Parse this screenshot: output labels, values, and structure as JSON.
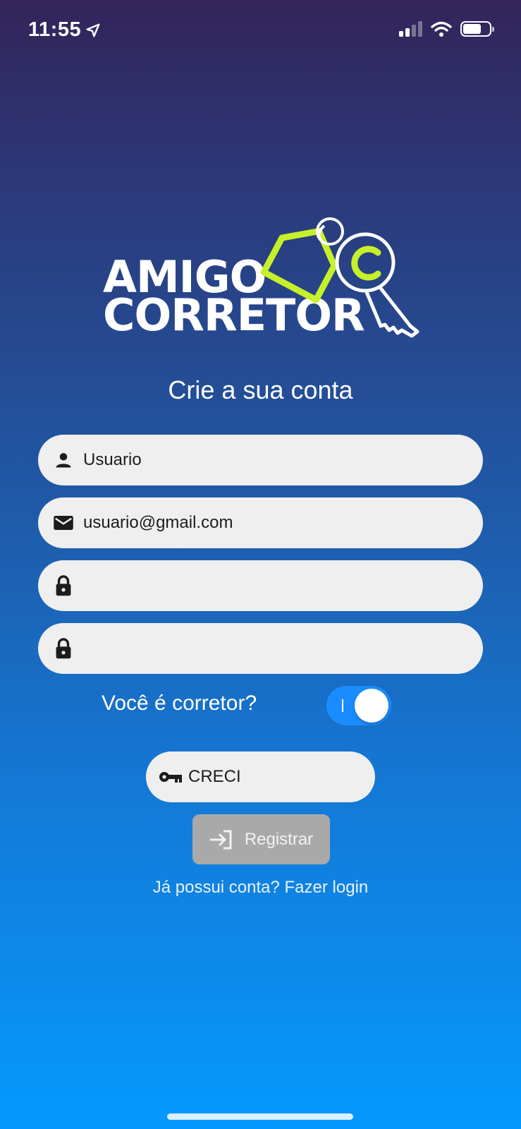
{
  "status_bar": {
    "time": "11:55",
    "icons": [
      "location-arrow-icon",
      "signal-icon",
      "wifi-icon",
      "battery-icon"
    ]
  },
  "logo": {
    "line1": "AMIGO",
    "line2": "CORRETOR",
    "accent": "#c6f028"
  },
  "title": "Crie a sua conta",
  "form": {
    "username": {
      "value": "Usuario",
      "icon": "person-icon"
    },
    "email": {
      "value": "usuario@gmail.com",
      "icon": "mail-icon"
    },
    "password": {
      "value": "",
      "icon": "lock-icon"
    },
    "confirm_password": {
      "value": "",
      "icon": "lock-icon"
    },
    "broker_toggle": {
      "label": "Você é corretor?",
      "on": true
    },
    "creci": {
      "value": "CRECI",
      "icon": "key-icon"
    },
    "register_label": "Registrar",
    "login_link": "Já possui conta? Fazer login"
  },
  "colors": {
    "toggle_on": "#1a8cff",
    "field_bg": "#efefef",
    "button_disabled": "#a9a9a9"
  }
}
